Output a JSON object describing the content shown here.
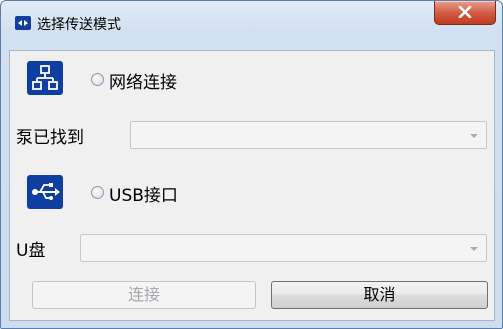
{
  "window": {
    "title": "选择传送模式",
    "close_glyph": "X"
  },
  "network": {
    "icon": "network-icon",
    "radio_label": "网络连接",
    "selected": false
  },
  "pump": {
    "label": "泵已找到",
    "value": ""
  },
  "usb": {
    "icon": "usb-icon",
    "radio_label": "USB接口",
    "selected": false
  },
  "udisk": {
    "label": "U盘",
    "value": ""
  },
  "buttons": {
    "connect": "连接",
    "cancel": "取消"
  },
  "colors": {
    "accent": "#0e3fa0",
    "close": "#c13a22"
  }
}
